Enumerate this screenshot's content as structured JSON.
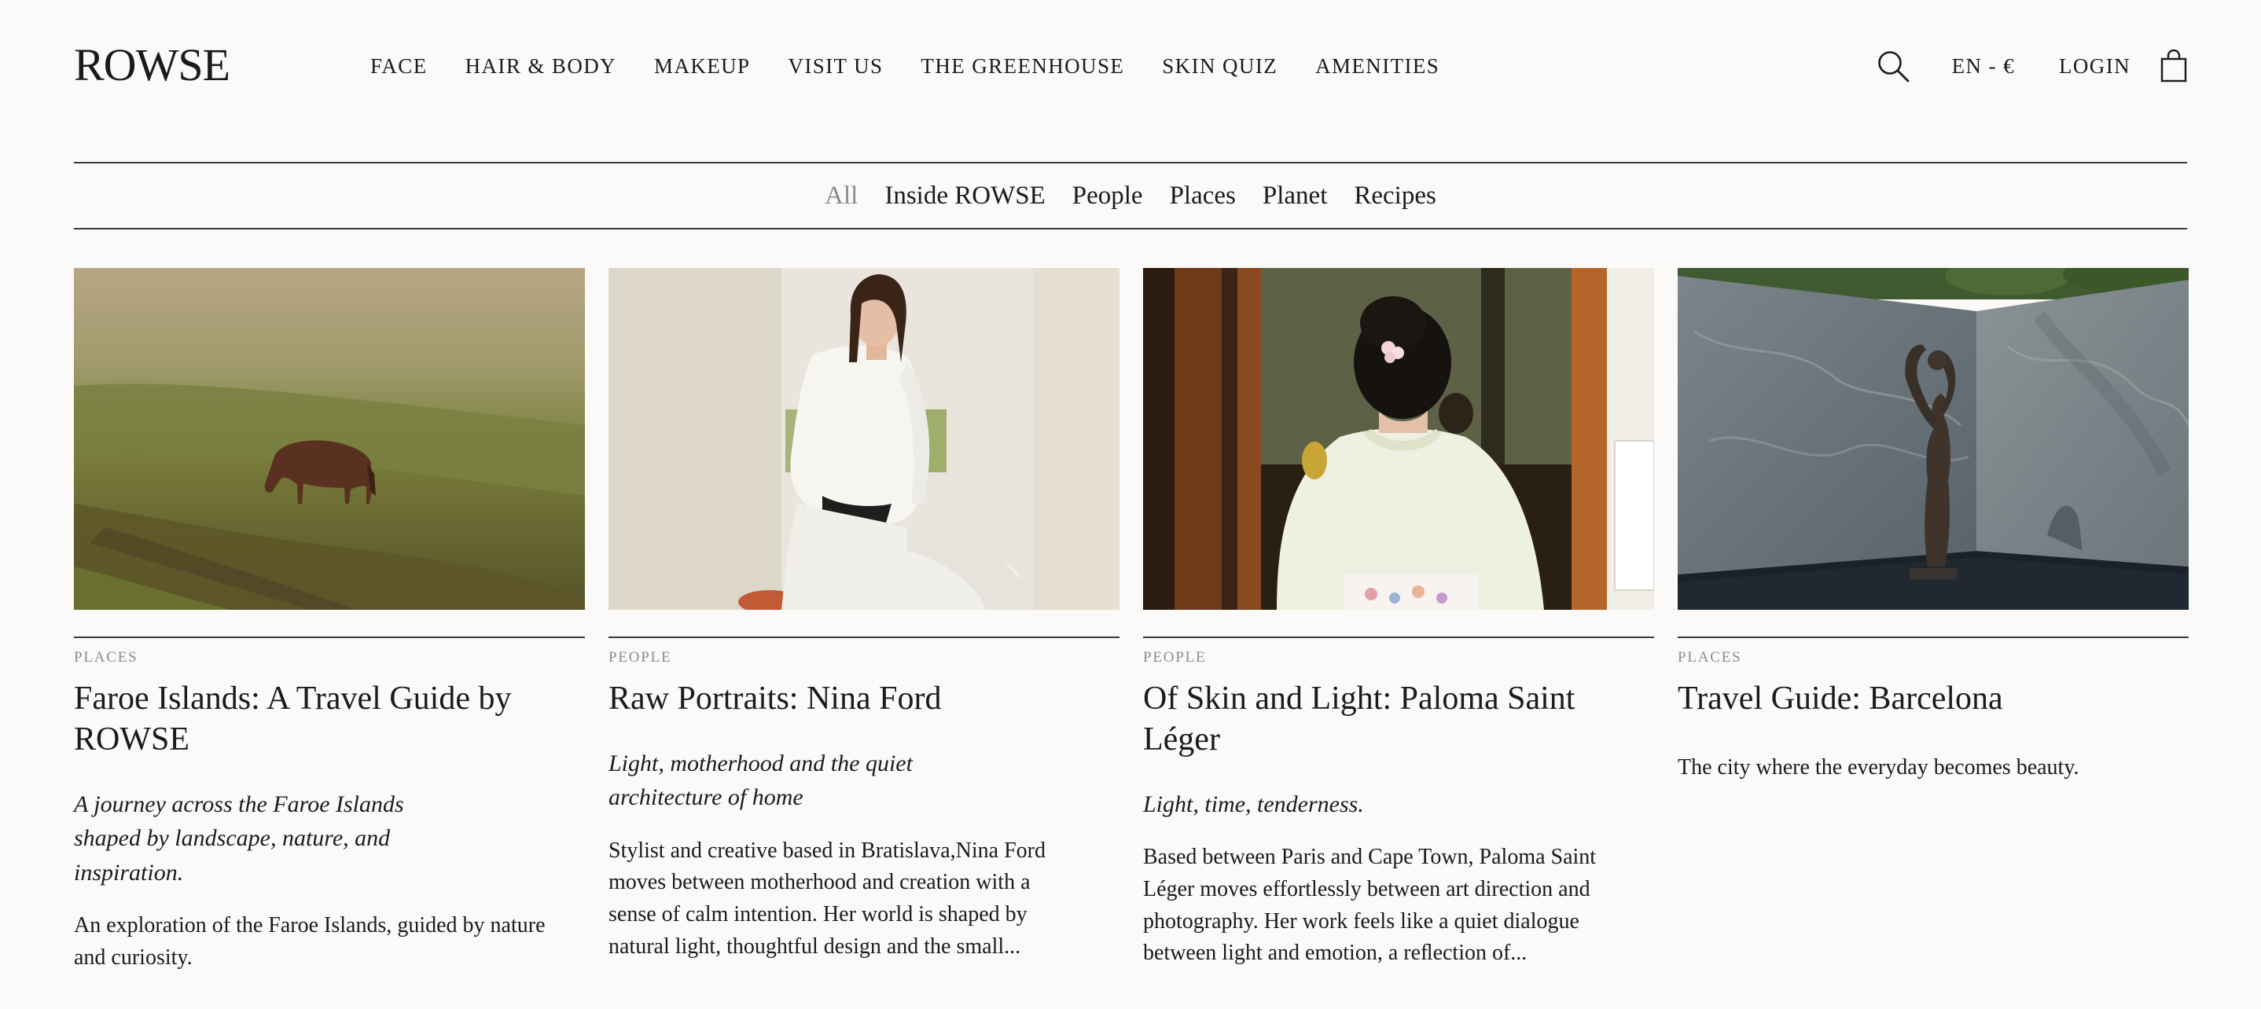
{
  "brand": {
    "logo": "ROWSE"
  },
  "main_nav": {
    "items": [
      "FACE",
      "HAIR & BODY",
      "MAKEUP",
      "VISIT US",
      "THE GREENHOUSE",
      "SKIN QUIZ",
      "AMENITIES"
    ]
  },
  "header_right": {
    "search_icon": "search-icon",
    "language": "EN - €",
    "login": "LOGIN",
    "bag_icon": "shopping-bag-icon"
  },
  "categories": {
    "active": "All",
    "items": [
      "All",
      "Inside ROWSE",
      "People",
      "Places",
      "Planet",
      "Recipes"
    ]
  },
  "cards": [
    {
      "category": "PLACES",
      "title_lines": [
        "Faroe Islands: A Travel Guide by",
        "ROWSE"
      ],
      "subtitle_lines": [
        "A journey across the Faroe Islands",
        "shaped by landscape, nature, and",
        "inspiration."
      ],
      "excerpt_lines": [
        "An exploration of the Faroe Islands, guided by nature",
        "and curiosity."
      ]
    },
    {
      "category": "PEOPLE",
      "title_lines": [
        "Raw Portraits: Nina Ford"
      ],
      "subtitle_lines": [
        "Light, motherhood and the quiet",
        "architecture of home"
      ],
      "excerpt_lines": [
        "Stylist and creative based in Bratislava,Nina Ford",
        "moves between motherhood and creation with a",
        "sense of calm intention. Her world is shaped by",
        "natural light, thoughtful design and the small..."
      ]
    },
    {
      "category": "PEOPLE",
      "title_lines": [
        "Of Skin and Light: Paloma Saint Léger"
      ],
      "subtitle_lines": [
        "Light, time, tenderness."
      ],
      "excerpt_lines": [
        "Based between Paris and Cape Town, Paloma Saint",
        "Léger moves effortlessly between art direction and",
        "photography. Her work feels like a quiet dialogue",
        "between light and emotion, a reﬂection of..."
      ]
    },
    {
      "category": "PLACES",
      "title_lines": [
        "Travel Guide: Barcelona"
      ],
      "subtitle_lines": [],
      "excerpt_lines": [
        "The city where the everyday becomes beauty."
      ]
    }
  ],
  "colors": {
    "background": "#fbfaf8",
    "text": "#1b1b1b",
    "muted": "#8c8c8c",
    "rule": "#3a3a3a"
  }
}
